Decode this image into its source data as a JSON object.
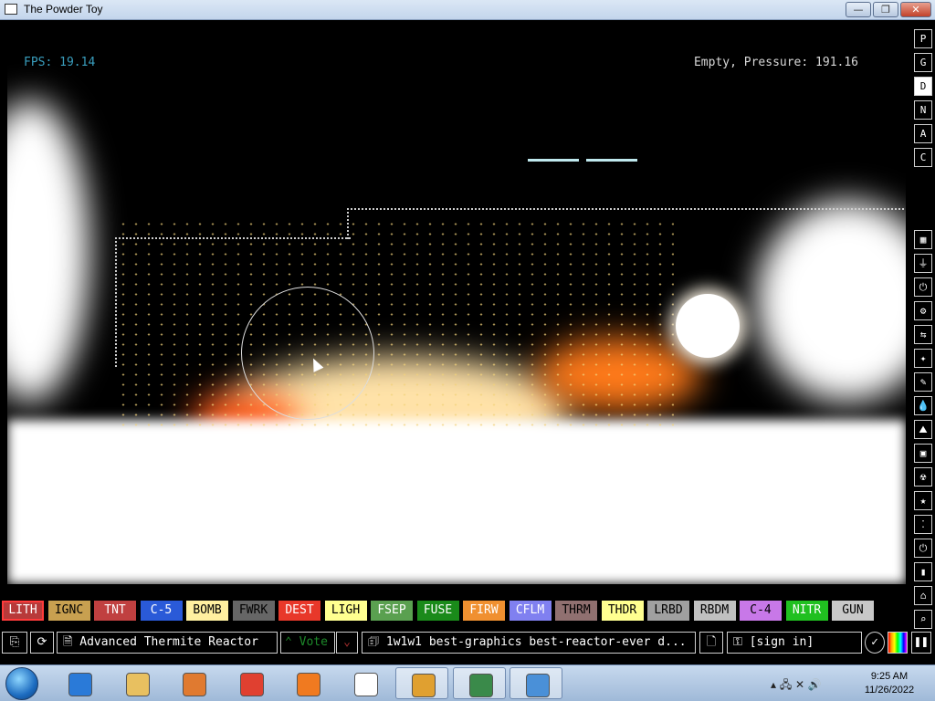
{
  "window": {
    "title": "The Powder Toy",
    "min": "—",
    "max": "❐",
    "close": "✕"
  },
  "hud": {
    "fps": "FPS: 19.14",
    "pressure": "Empty, Pressure: 191.16"
  },
  "right_tools": [
    "P",
    "G",
    "D",
    "N",
    "A",
    "C",
    "▦",
    "⏚",
    "⏻",
    "⚙",
    "⇆",
    "✦",
    "✎",
    "💧",
    "⛰",
    "▣",
    "☢",
    "★",
    "⁚",
    "⏻",
    "▮",
    "⌂",
    "⌕"
  ],
  "elements": [
    {
      "label": "LITH",
      "bg": "#b83a3a",
      "fg": "#ffffff",
      "selected": true
    },
    {
      "label": "IGNC",
      "bg": "#c8a050",
      "fg": "#000000"
    },
    {
      "label": "TNT",
      "bg": "#c04040",
      "fg": "#ffffff"
    },
    {
      "label": "C-5",
      "bg": "#2a5ad8",
      "fg": "#ffffff"
    },
    {
      "label": "BOMB",
      "bg": "#fff0a0",
      "fg": "#000000"
    },
    {
      "label": "FWRK",
      "bg": "#666666",
      "fg": "#000000"
    },
    {
      "label": "DEST",
      "bg": "#e8382a",
      "fg": "#ffffff"
    },
    {
      "label": "LIGH",
      "bg": "#ffff90",
      "fg": "#000000"
    },
    {
      "label": "FSEP",
      "bg": "#5aa050",
      "fg": "#ffffff"
    },
    {
      "label": "FUSE",
      "bg": "#1a8a1a",
      "fg": "#ffffff"
    },
    {
      "label": "FIRW",
      "bg": "#f09030",
      "fg": "#ffffff"
    },
    {
      "label": "CFLM",
      "bg": "#8080f0",
      "fg": "#ffffff"
    },
    {
      "label": "THRM",
      "bg": "#907070",
      "fg": "#000000"
    },
    {
      "label": "THDR",
      "bg": "#ffff90",
      "fg": "#000000"
    },
    {
      "label": "LRBD",
      "bg": "#a0a0a0",
      "fg": "#000000"
    },
    {
      "label": "RBDM",
      "bg": "#c0c0c0",
      "fg": "#000000"
    },
    {
      "label": "C-4",
      "bg": "#c878e8",
      "fg": "#000000"
    },
    {
      "label": "NITR",
      "bg": "#20c020",
      "fg": "#ffffff"
    },
    {
      "label": "GUN",
      "bg": "#c8c8c8",
      "fg": "#000000"
    }
  ],
  "bottom_bar": {
    "save_title": "Advanced Thermite Reactor",
    "vote": "Vote",
    "tags": "1w1w1 best-graphics best-reactor-ever d...",
    "sign_in": "[sign in]"
  },
  "taskbar": {
    "apps": [
      "internet-explorer",
      "file-explorer",
      "media-player",
      "chrome",
      "firefox",
      "7zip",
      "the-powder-toy",
      "network-tool",
      "control-panel"
    ],
    "time": "9:25 AM",
    "date": "11/26/2022"
  }
}
